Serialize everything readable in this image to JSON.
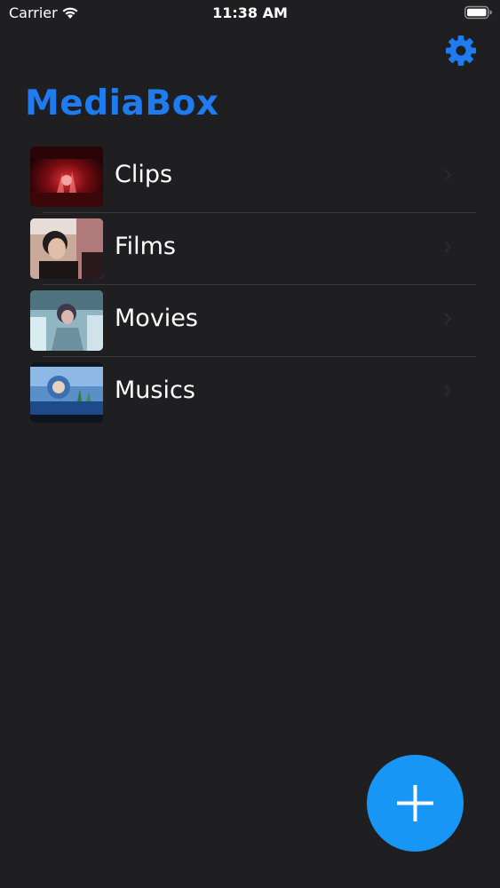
{
  "status_bar": {
    "carrier": "Carrier",
    "time": "11:38 AM",
    "wifi_icon": "wifi-icon",
    "battery_icon": "battery-icon"
  },
  "header": {
    "title": "MediaBox",
    "settings_icon": "gear-icon"
  },
  "colors": {
    "background": "#1f1f21",
    "title": "#1e7cf0",
    "accent": "#1796f5",
    "separator": "#3a3a3c"
  },
  "folders": [
    {
      "label": "Clips"
    },
    {
      "label": "Films"
    },
    {
      "label": "Movies"
    },
    {
      "label": "Musics"
    }
  ],
  "add_button": {
    "icon": "plus-icon"
  }
}
